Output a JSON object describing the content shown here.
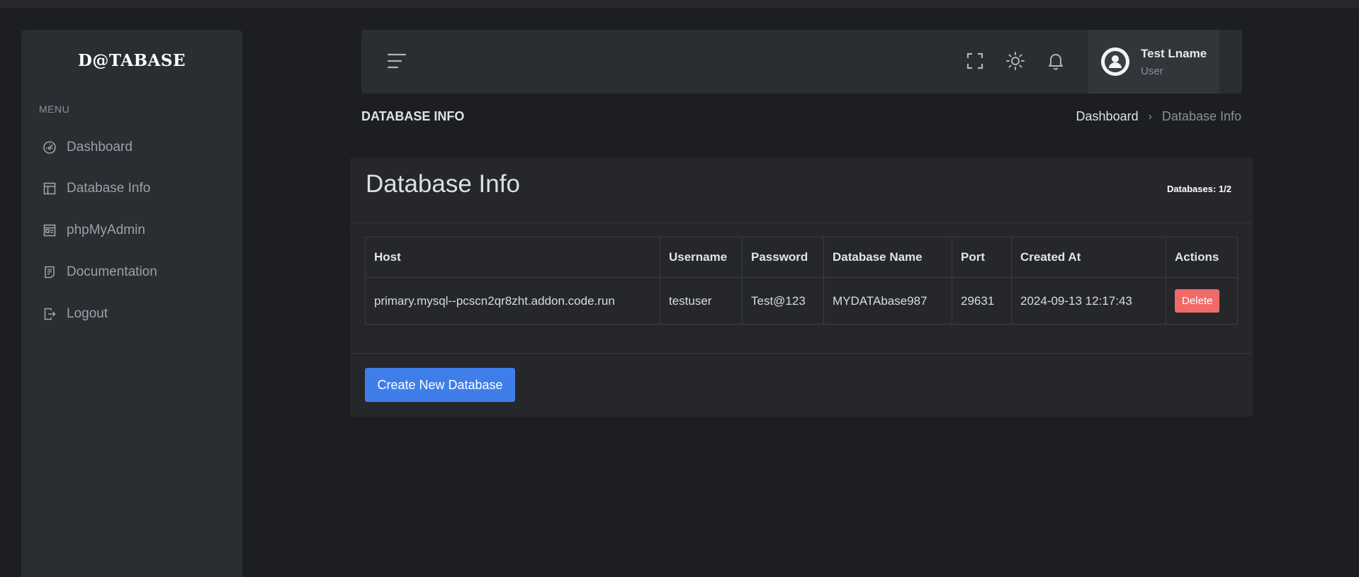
{
  "sidebar": {
    "logo": "D@TABASE",
    "menu_title": "MENU",
    "items": [
      {
        "label": "Dashboard",
        "icon": "gauge-icon"
      },
      {
        "label": "Database Info",
        "icon": "layout-icon"
      },
      {
        "label": "phpMyAdmin",
        "icon": "id-card-icon"
      },
      {
        "label": "Documentation",
        "icon": "document-icon"
      },
      {
        "label": "Logout",
        "icon": "logout-icon"
      }
    ]
  },
  "header": {
    "user_name": "Test Lname",
    "user_role": "User",
    "icons": [
      "menu-icon",
      "fullscreen-icon",
      "sun-icon",
      "bell-icon",
      "user-avatar-icon"
    ]
  },
  "page": {
    "title": "DATABASE INFO",
    "breadcrumb": {
      "home": "Dashboard",
      "separator": "›",
      "current": "Database Info"
    }
  },
  "card": {
    "title": "Database Info",
    "db_count": "Databases: 1/2",
    "table": {
      "headers": [
        "Host",
        "Username",
        "Password",
        "Database Name",
        "Port",
        "Created At",
        "Actions"
      ],
      "rows": [
        {
          "host": "primary.mysql--pcscn2qr8zht.addon.code.run",
          "username": "testuser",
          "password": "Test@123",
          "database_name": "MYDATAbase987",
          "port": "29631",
          "created_at": "2024-09-13 12:17:43",
          "action_label": "Delete"
        }
      ]
    },
    "create_button": "Create New Database"
  },
  "colors": {
    "background": "#1c1e22",
    "panel": "#2a2d31",
    "card": "#25272b",
    "primary": "#3f7ee8",
    "danger": "#f06a6a"
  }
}
